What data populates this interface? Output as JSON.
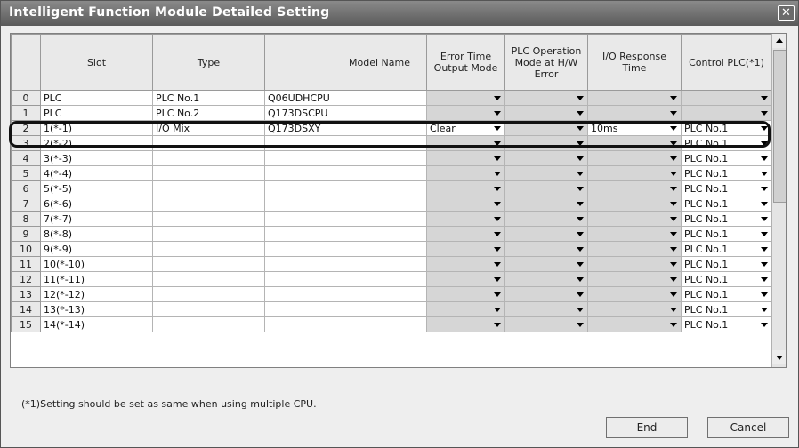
{
  "window": {
    "title": "Intelligent Function Module Detailed Setting"
  },
  "table": {
    "headers": [
      "",
      "Slot",
      "Type",
      "Model Name",
      "Error Time Output Mode",
      "PLC Operation Mode at H/W Error",
      "I/O Response Time",
      "Control PLC(*1)"
    ],
    "rows": [
      {
        "num": "0",
        "slot": "PLC",
        "type": "PLC No.1",
        "model": "Q06UDHCPU",
        "error_time": "",
        "plc_op": "",
        "io_resp": "",
        "control": ""
      },
      {
        "num": "1",
        "slot": "PLC",
        "type": "PLC No.2",
        "model": "Q173DSCPU",
        "error_time": "",
        "plc_op": "",
        "io_resp": "",
        "control": ""
      },
      {
        "num": "2",
        "slot": "1(*-1)",
        "type": "I/O Mix",
        "model": "Q173DSXY",
        "error_time": "Clear",
        "plc_op": "",
        "io_resp": "10ms",
        "control": "PLC No.1"
      },
      {
        "num": "3",
        "slot": "2(*-2)",
        "type": "",
        "model": "",
        "error_time": "",
        "plc_op": "",
        "io_resp": "",
        "control": "PLC No.1"
      },
      {
        "num": "4",
        "slot": "3(*-3)",
        "type": "",
        "model": "",
        "error_time": "",
        "plc_op": "",
        "io_resp": "",
        "control": "PLC No.1"
      },
      {
        "num": "5",
        "slot": "4(*-4)",
        "type": "",
        "model": "",
        "error_time": "",
        "plc_op": "",
        "io_resp": "",
        "control": "PLC No.1"
      },
      {
        "num": "6",
        "slot": "5(*-5)",
        "type": "",
        "model": "",
        "error_time": "",
        "plc_op": "",
        "io_resp": "",
        "control": "PLC No.1"
      },
      {
        "num": "7",
        "slot": "6(*-6)",
        "type": "",
        "model": "",
        "error_time": "",
        "plc_op": "",
        "io_resp": "",
        "control": "PLC No.1"
      },
      {
        "num": "8",
        "slot": "7(*-7)",
        "type": "",
        "model": "",
        "error_time": "",
        "plc_op": "",
        "io_resp": "",
        "control": "PLC No.1"
      },
      {
        "num": "9",
        "slot": "8(*-8)",
        "type": "",
        "model": "",
        "error_time": "",
        "plc_op": "",
        "io_resp": "",
        "control": "PLC No.1"
      },
      {
        "num": "10",
        "slot": "9(*-9)",
        "type": "",
        "model": "",
        "error_time": "",
        "plc_op": "",
        "io_resp": "",
        "control": "PLC No.1"
      },
      {
        "num": "11",
        "slot": "10(*-10)",
        "type": "",
        "model": "",
        "error_time": "",
        "plc_op": "",
        "io_resp": "",
        "control": "PLC No.1"
      },
      {
        "num": "12",
        "slot": "11(*-11)",
        "type": "",
        "model": "",
        "error_time": "",
        "plc_op": "",
        "io_resp": "",
        "control": "PLC No.1"
      },
      {
        "num": "13",
        "slot": "12(*-12)",
        "type": "",
        "model": "",
        "error_time": "",
        "plc_op": "",
        "io_resp": "",
        "control": "PLC No.1"
      },
      {
        "num": "14",
        "slot": "13(*-13)",
        "type": "",
        "model": "",
        "error_time": "",
        "plc_op": "",
        "io_resp": "",
        "control": "PLC No.1"
      },
      {
        "num": "15",
        "slot": "14(*-14)",
        "type": "",
        "model": "",
        "error_time": "",
        "plc_op": "",
        "io_resp": "",
        "control": "PLC No.1"
      }
    ]
  },
  "footnote": "(*1)Setting should be set as same when using multiple CPU.",
  "buttons": {
    "end": "End",
    "cancel": "Cancel"
  },
  "icons": {
    "close": "close-icon",
    "dropdown": "chevron-down-icon"
  },
  "colors": {
    "titlebar": "#6b6b6b",
    "header_bg": "#e9e9e9",
    "disabled_cell": "#d6d6d6"
  }
}
